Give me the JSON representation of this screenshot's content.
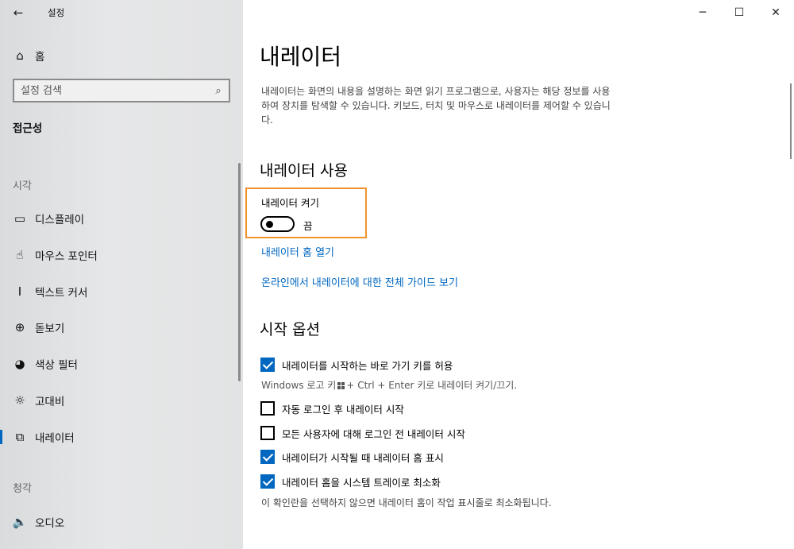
{
  "window": {
    "app_title": "설정",
    "back_glyph": "←",
    "controls": {
      "minimize": "─",
      "maximize": "☐",
      "close": "✕"
    }
  },
  "sidebar": {
    "home": {
      "icon": "home-icon",
      "glyph": "⌂",
      "label": "홈"
    },
    "search": {
      "placeholder": "설정 검색",
      "icon": "search-icon",
      "glyph": "⌕"
    },
    "category": "접근성",
    "sections": [
      {
        "title": "시각",
        "items": [
          {
            "icon": "display-icon",
            "glyph": "▭",
            "label": "디스플레이"
          },
          {
            "icon": "mouse-pointer-icon",
            "glyph": "☝",
            "label": "마우스 포인터"
          },
          {
            "icon": "text-cursor-icon",
            "glyph": "I",
            "label": "텍스트 커서"
          },
          {
            "icon": "magnifier-icon",
            "glyph": "⊕",
            "label": "돋보기"
          },
          {
            "icon": "color-filter-icon",
            "glyph": "◕",
            "label": "색상 필터"
          },
          {
            "icon": "high-contrast-icon",
            "glyph": "☼",
            "label": "고대비"
          },
          {
            "icon": "narrator-icon",
            "glyph": "⧉",
            "label": "내레이터",
            "active": true
          }
        ]
      },
      {
        "title": "청각",
        "items": [
          {
            "icon": "audio-icon",
            "glyph": "🔈",
            "label": "오디오"
          }
        ]
      }
    ]
  },
  "main": {
    "title": "내레이터",
    "description": "내레이터는 화면의 내용을 설명하는 화면 읽기 프로그램으로, 사용자는 해당 정보를 사용하여 장치를 탐색할 수 있습니다. 키보드, 터치 및 마우스로 내레이터를 제어할 수 있습니다.",
    "use_section": {
      "title": "내레이터 사용",
      "toggle_label": "내레이터 켜기",
      "toggle_state": "끔",
      "toggle_on": false,
      "links": [
        "내레이터 홈 열기",
        "온라인에서 내레이터에 대한 전체 가이드 보기"
      ]
    },
    "startup_section": {
      "title": "시작 옵션",
      "options": [
        {
          "label": "내레이터를 시작하는 바로 가기 키를 허용",
          "checked": true
        },
        {
          "label": "자동 로그인 후 내레이터 시작",
          "checked": false
        },
        {
          "label": "모든 사용자에 대해 로그인 전 내레이터 시작",
          "checked": false
        },
        {
          "label": "내레이터가 시작될 때 내레이터 홈 표시",
          "checked": true
        },
        {
          "label": "내레이터 홈을 시스템 트레이로 최소화",
          "checked": true
        }
      ],
      "shortcut_hint_pre": "Windows 로고 키",
      "shortcut_hint_post": "+ Ctrl + Enter 키로 내레이터 켜기/끄기.",
      "tray_hint": "이 확인란을 선택하지 않으면 내레이터 홈이 작업 표시줄로 최소화됩니다."
    }
  },
  "colors": {
    "accent": "#0067c0",
    "highlight_box": "#f0932b",
    "sidebar_bg": "#e4e5e6"
  }
}
